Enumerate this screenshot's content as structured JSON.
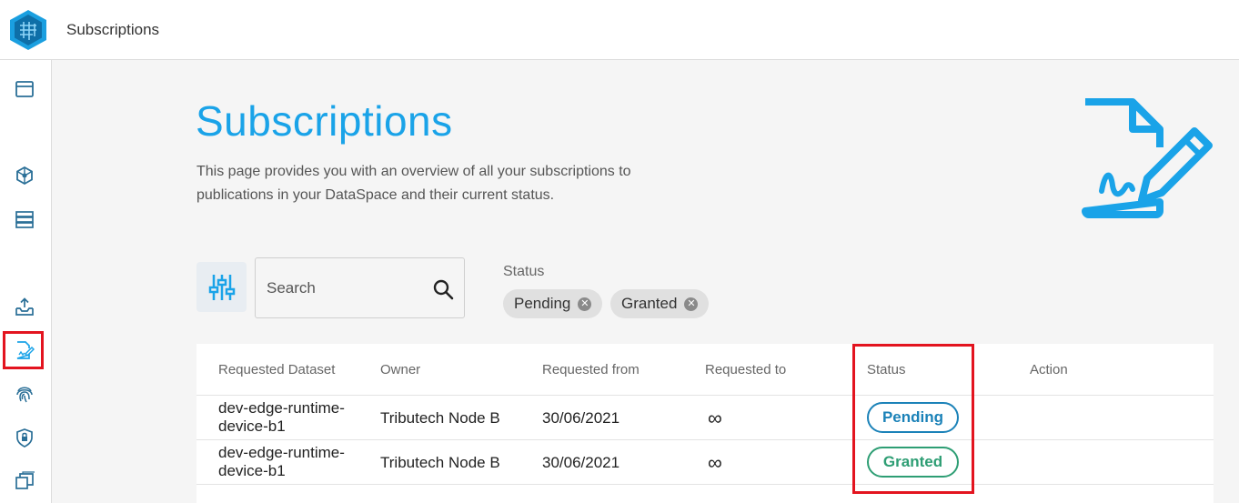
{
  "header": {
    "title": "Subscriptions",
    "logo_icon": "hex-cube-logo"
  },
  "sidebar": {
    "items": [
      {
        "icon": "window-icon"
      },
      {
        "icon": "network-hex-icon"
      },
      {
        "icon": "server-icon"
      },
      {
        "icon": "upload-tray-icon"
      },
      {
        "icon": "subscription-sign-icon",
        "active": true
      },
      {
        "icon": "fingerprint-icon"
      },
      {
        "icon": "shield-lock-icon"
      },
      {
        "icon": "stacked-windows-icon"
      }
    ]
  },
  "main": {
    "title": "Subscriptions",
    "description": "This page provides you with an overview of all your subscriptions to publications in your DataSpace and their current status.",
    "hero_icon": "document-signature-pen-icon"
  },
  "filters": {
    "search_placeholder": "Search",
    "status_label": "Status",
    "chips": [
      "Pending",
      "Granted"
    ]
  },
  "table": {
    "columns": [
      "Requested Dataset",
      "Owner",
      "Requested from",
      "Requested to",
      "Status",
      "Action"
    ],
    "rows": [
      {
        "dataset": "dev-edge-runtime-device-b1",
        "owner": "Tributech Node B",
        "from": "30/06/2021",
        "to": "∞",
        "status": "Pending"
      },
      {
        "dataset": "dev-edge-runtime-device-b1",
        "owner": "Tributech Node B",
        "from": "30/06/2021",
        "to": "∞",
        "status": "Granted"
      }
    ]
  },
  "colors": {
    "accent": "#1aa3e8",
    "pending": "#1b82b8",
    "granted": "#2e9e74",
    "highlight": "#e3141f"
  }
}
